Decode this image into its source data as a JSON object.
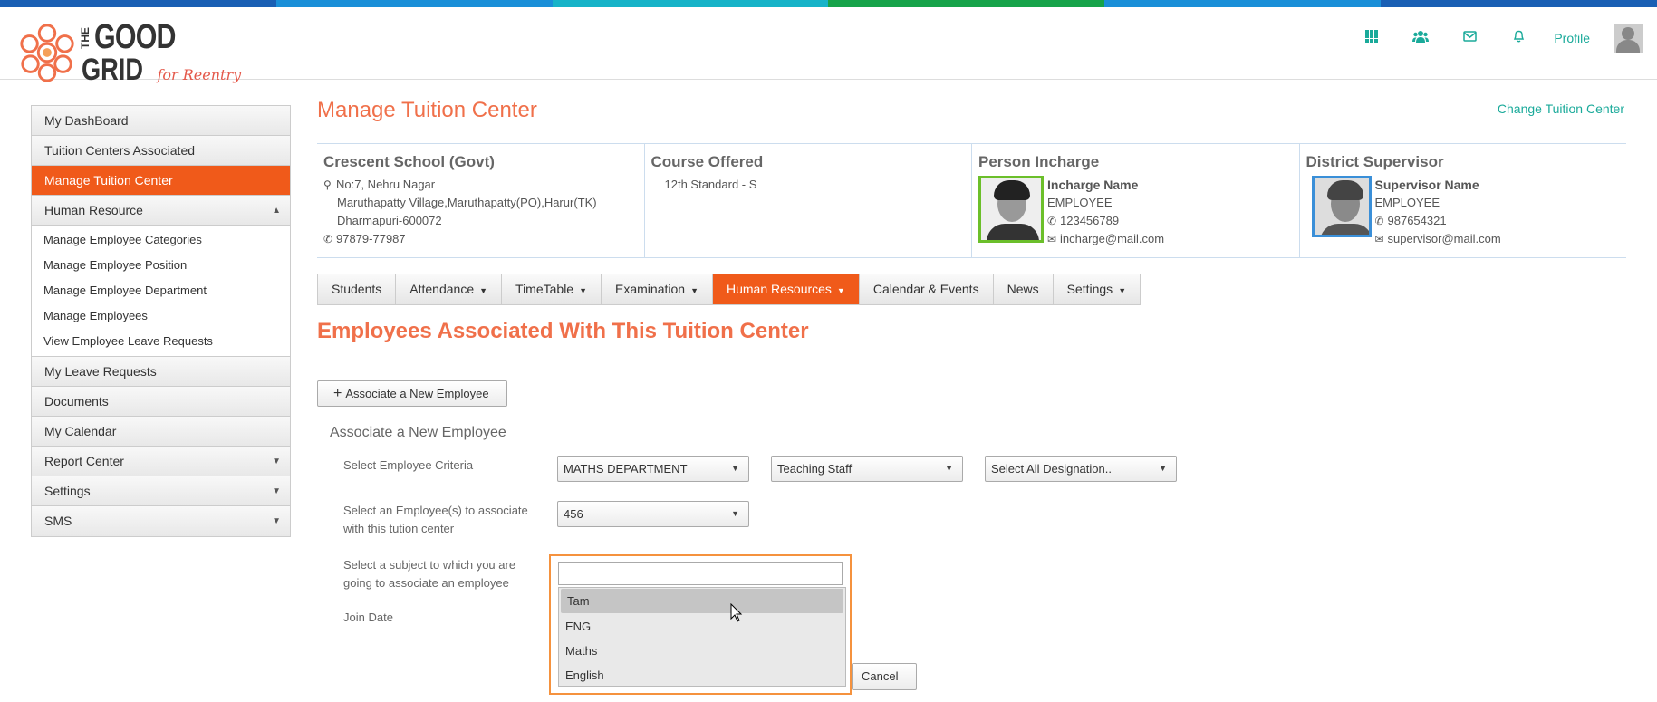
{
  "brand": {
    "stripe_colors": [
      "#1a5fb4",
      "#1a8fd8",
      "#17b3c8",
      "#16a34a",
      "#1a8fd8"
    ],
    "logo_the": "THE",
    "logo_good": "GOOD",
    "logo_grid": "GRID",
    "logo_tagline": "for Reentry",
    "accent": "#f05a1a",
    "teal": "#1aaa9a"
  },
  "header": {
    "icons": [
      "apps-grid-icon",
      "users-icon",
      "mail-icon",
      "bell-icon"
    ],
    "profile_label": "Profile"
  },
  "sidebar": {
    "items": [
      {
        "label": "My DashBoard"
      },
      {
        "label": "Tuition Centers Associated"
      },
      {
        "label": "Manage Tuition Center",
        "active": true
      },
      {
        "label": "Human Resource",
        "expanded": true
      }
    ],
    "hr_sub": [
      "Manage Employee Categories",
      "Manage Employee Position",
      "Manage Employee Department",
      "Manage Employees",
      "View Employee Leave Requests"
    ],
    "items_after": [
      {
        "label": "My Leave Requests"
      },
      {
        "label": "Documents"
      },
      {
        "label": "My Calendar"
      },
      {
        "label": "Report Center"
      },
      {
        "label": "Settings"
      },
      {
        "label": "SMS"
      }
    ]
  },
  "main": {
    "title": "Manage Tuition Center",
    "change_link": "Change Tuition Center",
    "school": {
      "name": "Crescent School (Govt)",
      "addr1": "No:7, Nehru Nagar",
      "addr2": "Maruthapatty Village,Maruthapatty(PO),Harur(TK)",
      "addr3": "Dharmapuri-600072",
      "phone": "97879-77987"
    },
    "course": {
      "heading": "Course Offered",
      "value": "12th Standard - S"
    },
    "incharge": {
      "heading": "Person Incharge",
      "name": "Incharge Name",
      "role": "EMPLOYEE",
      "phone": "123456789",
      "email": "incharge@mail.com"
    },
    "supervisor": {
      "heading": "District Supervisor",
      "name": "Supervisor Name",
      "role": "EMPLOYEE",
      "phone": "987654321",
      "email": "supervisor@mail.com"
    },
    "tabs": [
      {
        "label": "Students"
      },
      {
        "label": "Attendance",
        "caret": true
      },
      {
        "label": "TimeTable",
        "caret": true
      },
      {
        "label": "Examination",
        "caret": true
      },
      {
        "label": "Human Resources",
        "caret": true,
        "active": true
      },
      {
        "label": "Calendar & Events"
      },
      {
        "label": "News"
      },
      {
        "label": "Settings",
        "caret": true
      }
    ],
    "section_title": "Employees Associated With This Tuition Center",
    "associate_button": "Associate a New Employee",
    "form": {
      "title": "Associate a New Employee",
      "criteria_label": "Select Employee Criteria",
      "department": "MATHS DEPARTMENT",
      "staff_type": "Teaching Staff",
      "designation": "Select All Designation..",
      "employee_label_1": "Select an Employee(s) to associate",
      "employee_label_2": "with this tution center",
      "employee_value": "456",
      "subject_label_1": "Select a subject to which you are",
      "subject_label_2": "going to associate an employee",
      "join_date_label": "Join Date",
      "subject_options": [
        "Tam",
        "ENG",
        "Maths",
        "English"
      ],
      "cancel_label": "Cancel"
    }
  }
}
